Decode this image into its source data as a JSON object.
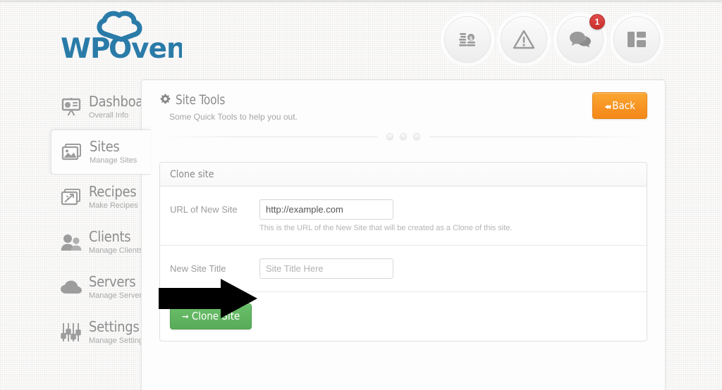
{
  "brand": {
    "name": "WPOven",
    "logo_part1": "WP",
    "logo_part2": "Oven",
    "color": "#2a7ba8"
  },
  "header": {
    "icons": [
      {
        "name": "billing-coins-icon",
        "label": "Billing"
      },
      {
        "name": "alerts-warning-icon",
        "label": "Alerts"
      },
      {
        "name": "support-chat-icon",
        "label": "Support",
        "badge": "1"
      },
      {
        "name": "layout-panels-icon",
        "label": "Layout"
      }
    ]
  },
  "sidebar": {
    "items": [
      {
        "title": "Dashboard",
        "subtitle": "Overall Info",
        "icon": "dashboard-chart-icon",
        "active": false
      },
      {
        "title": "Sites",
        "subtitle": "Manage Sites",
        "icon": "sites-image-icon",
        "active": true
      },
      {
        "title": "Recipes",
        "subtitle": "Make Recipes",
        "icon": "recipes-magic-icon",
        "active": false
      },
      {
        "title": "Clients",
        "subtitle": "Manage Clients",
        "icon": "clients-users-icon",
        "active": false
      },
      {
        "title": "Servers",
        "subtitle": "Manage Servers",
        "icon": "servers-cloud-icon",
        "active": false
      },
      {
        "title": "Settings",
        "subtitle": "Manage Settings",
        "icon": "settings-sliders-icon",
        "active": false
      }
    ]
  },
  "panel": {
    "title": "Site Tools",
    "title_icon": "gear-icon",
    "subtitle": "Some Quick Tools to help you out.",
    "back_button": {
      "label": "Back",
      "icon": "rewind-icon",
      "color": "#f79422"
    },
    "divider_dot_count": 3
  },
  "clone_card": {
    "heading": "Clone site",
    "rows": [
      {
        "label": "URL of New Site",
        "input_name": "clone-url-input",
        "value": "http://example.com",
        "placeholder": "http://example.com",
        "help": "This is the URL of the New Site that will be created as a Clone of this site."
      },
      {
        "label": "New Site Title",
        "input_name": "clone-title-input",
        "value": "",
        "placeholder": "Site Title Here",
        "help": ""
      }
    ],
    "submit": {
      "label": "Clone Site",
      "icon": "arrow-right-icon",
      "color": "#5cb85c"
    }
  },
  "annotation": {
    "arrow": {
      "name": "highlight-arrow",
      "points_to": "Clone Site"
    }
  }
}
